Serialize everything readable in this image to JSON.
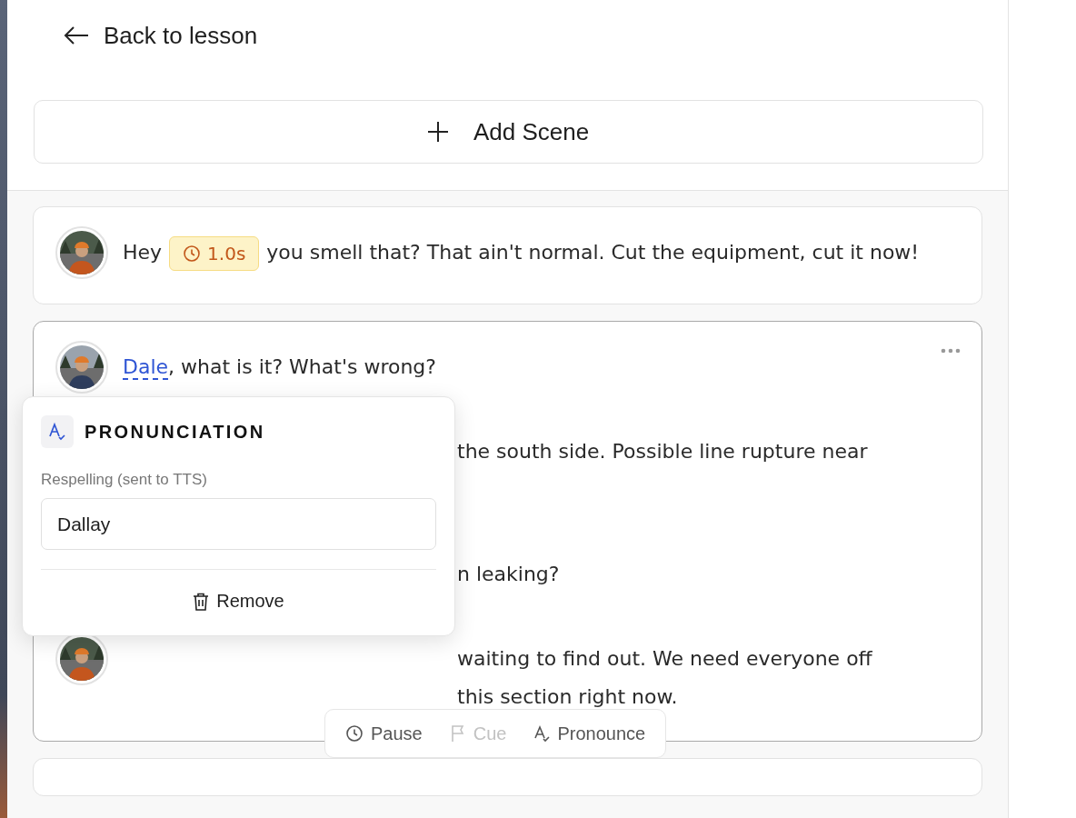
{
  "back_link": "Back to lesson",
  "add_scene_button": "Add Scene",
  "cards": [
    {
      "selected": false,
      "has_menu": false,
      "entries": [
        {
          "kind": "full",
          "avatar_visible": true,
          "segments": [
            {
              "kind": "text",
              "text": "Hey"
            },
            {
              "kind": "pause",
              "text": "1.0s"
            },
            {
              "kind": "text",
              "text": "you smell that? That ain't normal. Cut the equipment, cut it now!"
            }
          ]
        }
      ]
    },
    {
      "selected": true,
      "has_menu": true,
      "entries": [
        {
          "kind": "full",
          "avatar_visible": true,
          "segments": [
            {
              "kind": "pronounced",
              "text": "Dale"
            },
            {
              "kind": "text",
              "text": ", what is it? What's wrong?"
            }
          ]
        },
        {
          "kind": "covered",
          "avatar_visible": false,
          "visible_lines": [
            "the south side. Possible line rupture near"
          ]
        },
        {
          "kind": "covered",
          "avatar_visible": false,
          "visible_lines": [
            "n leaking?"
          ]
        },
        {
          "kind": "covered",
          "avatar_visible": true,
          "visible_lines": [
            "waiting to find out. We need everyone off",
            "this section right now."
          ]
        }
      ]
    }
  ],
  "pronunciation_popup": {
    "title": "PRONUNCIATION",
    "field_label": "Respelling (sent to TTS)",
    "value": "Dallay",
    "remove_button": "Remove"
  },
  "toolbar": [
    {
      "kind": "pause",
      "label": "Pause",
      "disabled": false
    },
    {
      "kind": "cue",
      "label": "Cue",
      "disabled": true
    },
    {
      "kind": "pronounce",
      "label": "Pronounce",
      "disabled": false
    }
  ]
}
